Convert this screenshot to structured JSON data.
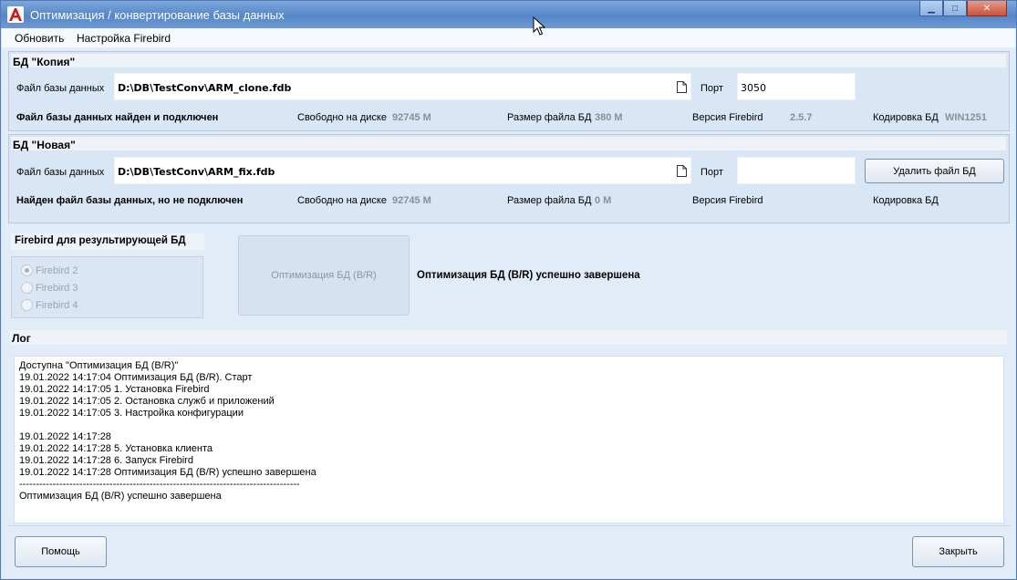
{
  "window": {
    "title": "Оптимизация / конвертирование базы данных",
    "controls": {
      "minimize": "▁",
      "maximize": "□",
      "close": "✕"
    }
  },
  "menu": [
    "Обновить",
    "Настройка Firebird"
  ],
  "copy_db": {
    "title": "БД \"Копия\"",
    "file_label": "Файл базы данных",
    "file_value": "D:\\DB\\TestConv\\ARM_clone.fdb",
    "port_label": "Порт",
    "port_value": "3050",
    "status": "Файл базы данных найден и подключен",
    "free_label": "Свободно на диске",
    "free_value": "92745 М",
    "size_label": "Размер файла  БД",
    "size_value": "380 М",
    "version_label": "Версия Firebird",
    "version_value": "2.5.7",
    "encoding_label": "Кодировка БД",
    "encoding_value": "WIN1251"
  },
  "new_db": {
    "title": "БД \"Новая\"",
    "file_label": "Файл базы данных",
    "file_value": "D:\\DB\\TestConv\\ARM_fix.fdb",
    "port_label": "Порт",
    "port_value": "",
    "delete_button": "Удалить файл БД",
    "status": "Найден файл базы данных, но не подключен",
    "free_label": "Свободно на диске",
    "free_value": "92745 М",
    "size_label": "Размер файла  БД",
    "size_value": "0 М",
    "version_label": "Версия Firebird",
    "version_value": "",
    "encoding_label": "Кодировка БД",
    "encoding_value": ""
  },
  "firebird": {
    "title": "Firebird для результирующей БД",
    "options": [
      "Firebird 2",
      "Firebird 3",
      "Firebird 4"
    ],
    "selected": "Firebird 2"
  },
  "optimize": {
    "button": "Оптимизация БД (B/R)",
    "status": "Оптимизация БД (B/R) успешно завершена"
  },
  "log": {
    "title": "Лог",
    "lines": [
      "Доступна \"Оптимизация БД (B/R)\"",
      "19.01.2022 14:17:04 Оптимизация БД (B/R). Старт",
      "19.01.2022 14:17:05 1. Установка Firebird",
      "19.01.2022 14:17:05 2. Остановка служб и приложений",
      "19.01.2022 14:17:05 3. Настройка конфигурации",
      "",
      "19.01.2022 14:17:28",
      "19.01.2022 14:17:28 5. Установка клиента",
      "19.01.2022 14:17:28 6. Запуск Firebird",
      "19.01.2022 14:17:28 Оптимизация БД (B/R) успешно завершена",
      "------------------------------------------------------------------------------------",
      "Оптимизация БД (B/R) успешно завершена"
    ]
  },
  "footer": {
    "help_button": "Помощь",
    "close_button": "Закрыть"
  }
}
